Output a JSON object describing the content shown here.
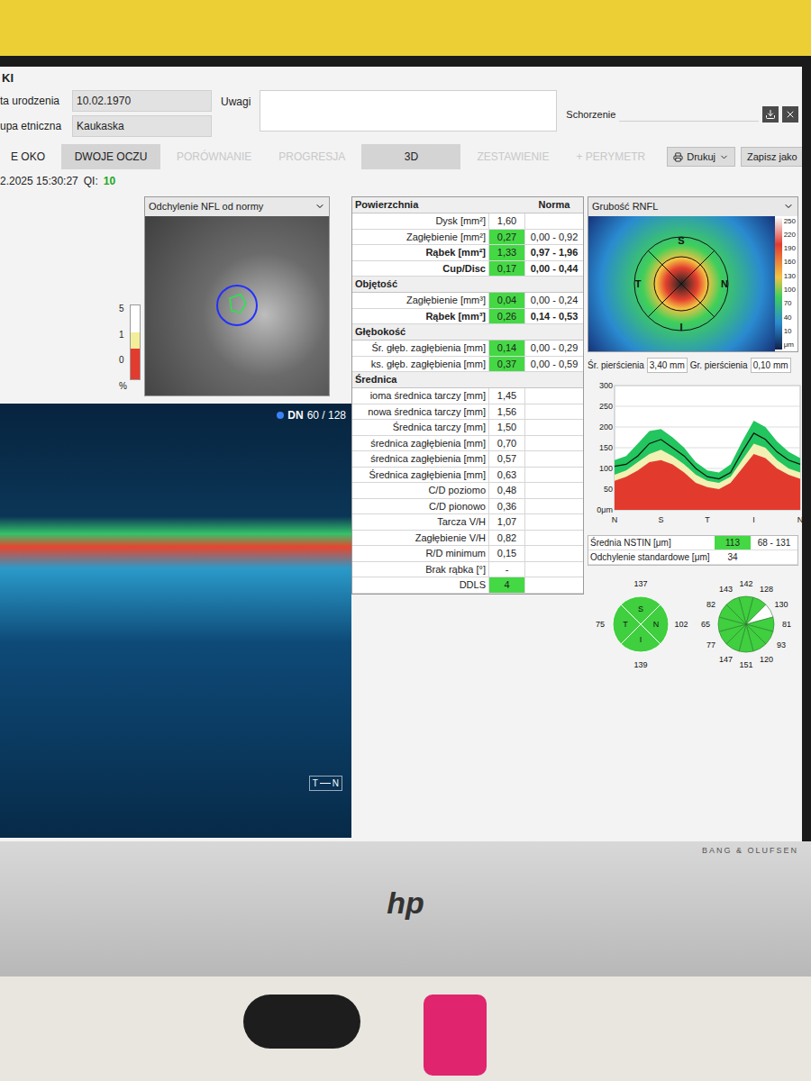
{
  "header": {
    "title": "KI",
    "fields": [
      {
        "label": "ta urodzenia",
        "value": "10.02.1970"
      },
      {
        "label": "upa etniczna",
        "value": "Kaukaska"
      }
    ],
    "notes_label": "Uwagi",
    "condition_label": "Schorzenie"
  },
  "tabs": [
    {
      "label": "E OKO",
      "selected": false,
      "disabled": false
    },
    {
      "label": "DWOJE OCZU",
      "selected": true,
      "disabled": false
    },
    {
      "label": "PORÓWNANIE",
      "selected": false,
      "disabled": true
    },
    {
      "label": "PROGRESJA",
      "selected": false,
      "disabled": true
    },
    {
      "label": "3D",
      "selected": true,
      "disabled": false
    },
    {
      "label": "ZESTAWIENIE",
      "selected": false,
      "disabled": true
    },
    {
      "label": "+ PERYMETR",
      "selected": false,
      "disabled": true
    }
  ],
  "toolbar": {
    "print": "Drukuj",
    "save": "Zapisz jako"
  },
  "exam": {
    "datetime": "2.2025 15:30:27",
    "qi_label": "QI:",
    "qi_value": "10"
  },
  "nfl_panel": {
    "title": "Odchylenie NFL od normy",
    "scale": [
      "5",
      "1",
      "0",
      "%"
    ]
  },
  "bscan": {
    "label": "DN",
    "slice": "60 / 128",
    "orientation": [
      "T",
      "N"
    ]
  },
  "table": {
    "norm_header": "Norma",
    "sections": [
      {
        "title": "Powierzchnia",
        "rows": [
          {
            "label": "Dysk [mm²]",
            "value": "1,60",
            "norm": "",
            "bold": false,
            "highlighted": false
          },
          {
            "label": "Zagłębienie [mm²]",
            "value": "0,27",
            "norm": "0,00 - 0,92",
            "bold": false,
            "highlighted": true
          },
          {
            "label": "Rąbek [mm²]",
            "value": "1,33",
            "norm": "0,97 - 1,96",
            "bold": true,
            "highlighted": true
          },
          {
            "label": "Cup/Disc",
            "value": "0,17",
            "norm": "0,00 - 0,44",
            "bold": true,
            "highlighted": true
          }
        ]
      },
      {
        "title": "Objętość",
        "rows": [
          {
            "label": "Zagłębienie [mm³]",
            "value": "0,04",
            "norm": "0,00 - 0,24",
            "bold": false,
            "highlighted": true
          },
          {
            "label": "Rąbek [mm³]",
            "value": "0,26",
            "norm": "0,14 - 0,53",
            "bold": true,
            "highlighted": true
          }
        ]
      },
      {
        "title": "Głębokość",
        "rows": [
          {
            "label": "Śr. głęb. zagłębienia [mm]",
            "value": "0,14",
            "norm": "0,00 - 0,29",
            "bold": false,
            "highlighted": true
          },
          {
            "label": "ks. głęb. zagłębienia [mm]",
            "value": "0,37",
            "norm": "0,00 - 0,59",
            "bold": false,
            "highlighted": true
          }
        ]
      },
      {
        "title": "Średnica",
        "rows": [
          {
            "label": "ioma średnica tarczy [mm]",
            "value": "1,45",
            "norm": "",
            "bold": false,
            "highlighted": false
          },
          {
            "label": "nowa średnica tarczy [mm]",
            "value": "1,56",
            "norm": "",
            "bold": false,
            "highlighted": false
          },
          {
            "label": "Średnica tarczy [mm]",
            "value": "1,50",
            "norm": "",
            "bold": false,
            "highlighted": false
          },
          {
            "label": "średnica zagłębienia [mm]",
            "value": "0,70",
            "norm": "",
            "bold": false,
            "highlighted": false
          },
          {
            "label": "średnica zagłębienia [mm]",
            "value": "0,57",
            "norm": "",
            "bold": false,
            "highlighted": false
          },
          {
            "label": "Średnica zagłębienia [mm]",
            "value": "0,63",
            "norm": "",
            "bold": false,
            "highlighted": false
          },
          {
            "label": "C/D poziomo",
            "value": "0,48",
            "norm": "",
            "bold": false,
            "highlighted": false
          },
          {
            "label": "C/D pionowo",
            "value": "0,36",
            "norm": "",
            "bold": false,
            "highlighted": false
          },
          {
            "label": "Tarcza V/H",
            "value": "1,07",
            "norm": "",
            "bold": false,
            "highlighted": false
          },
          {
            "label": "Zagłębienie V/H",
            "value": "0,82",
            "norm": "",
            "bold": false,
            "highlighted": false
          },
          {
            "label": "R/D minimum",
            "value": "0,15",
            "norm": "",
            "bold": false,
            "highlighted": false
          },
          {
            "label": "Brak rąbka [°]",
            "value": "-",
            "norm": "",
            "bold": false,
            "highlighted": false
          },
          {
            "label": "DDLS",
            "value": "4",
            "norm": "",
            "bold": false,
            "highlighted": true
          }
        ]
      }
    ]
  },
  "rnfl": {
    "title": "Grubość RNFL",
    "colorbar": [
      "250",
      "220",
      "190",
      "160",
      "130",
      "100",
      "70",
      "40",
      "10"
    ],
    "unit": "μm",
    "letters": [
      "S",
      "T",
      "N",
      "I"
    ]
  },
  "ring": {
    "diameter_label": "Śr. pierścienia",
    "diameter": "3,40 mm",
    "width_label": "Gr. pierścienia",
    "width": "0,10 mm"
  },
  "chart": {
    "y_ticks": [
      "300",
      "250",
      "200",
      "150",
      "100",
      "50",
      "0μm"
    ],
    "y_max": 300,
    "x_ticks": [
      "N",
      "S",
      "T",
      "I",
      "N"
    ],
    "series": [
      {
        "name": "normal-95",
        "kind": "area",
        "color": "#22c55e",
        "values": [
          120,
          130,
          160,
          190,
          195,
          175,
          150,
          115,
          95,
          90,
          110,
          165,
          215,
          200,
          165,
          140,
          125
        ]
      },
      {
        "name": "borderline-5",
        "kind": "area",
        "color": "#f3f0b4",
        "values": [
          85,
          95,
          115,
          135,
          145,
          130,
          110,
          85,
          70,
          65,
          80,
          120,
          160,
          150,
          120,
          100,
          90
        ]
      },
      {
        "name": "outside-1",
        "kind": "area",
        "color": "#e23b2e",
        "values": [
          70,
          80,
          95,
          115,
          120,
          110,
          90,
          65,
          55,
          50,
          65,
          100,
          135,
          125,
          100,
          85,
          75
        ]
      },
      {
        "name": "measured",
        "kind": "line",
        "color": "#111111",
        "values": [
          105,
          110,
          130,
          160,
          170,
          150,
          130,
          100,
          80,
          75,
          90,
          140,
          185,
          170,
          140,
          120,
          110
        ]
      }
    ]
  },
  "stats": [
    {
      "label": "Średnia NSTIN [μm]",
      "value": "113",
      "norm": "68 - 131",
      "highlighted": true
    },
    {
      "label": "Odchylenie standardowe [μm]",
      "value": "34",
      "norm": "",
      "highlighted": false
    }
  ],
  "quadrants": [
    {
      "letter": "S",
      "value": "137",
      "color": "#3fcf3f"
    },
    {
      "letter": "N",
      "value": "102",
      "color": "#3fcf3f"
    },
    {
      "letter": "I",
      "value": "139",
      "color": "#3fcf3f"
    },
    {
      "letter": "T",
      "value": "75",
      "color": "#3fcf3f"
    }
  ],
  "clock_hours": [
    {
      "value": "142",
      "color": "#3fcf3f"
    },
    {
      "value": "128",
      "color": "#3fcf3f"
    },
    {
      "value": "130",
      "color": "#ffffff"
    },
    {
      "value": "81",
      "color": "#3fcf3f"
    },
    {
      "value": "93",
      "color": "#3fcf3f"
    },
    {
      "value": "120",
      "color": "#3fcf3f"
    },
    {
      "value": "151",
      "color": "#3fcf3f"
    },
    {
      "value": "147",
      "color": "#3fcf3f"
    },
    {
      "value": "77",
      "color": "#3fcf3f"
    },
    {
      "value": "65",
      "color": "#3fcf3f"
    },
    {
      "value": "82",
      "color": "#3fcf3f"
    },
    {
      "value": "143",
      "color": "#3fcf3f"
    }
  ],
  "monitor": {
    "logo": "hp",
    "brand": "BANG & OLUFSEN"
  }
}
